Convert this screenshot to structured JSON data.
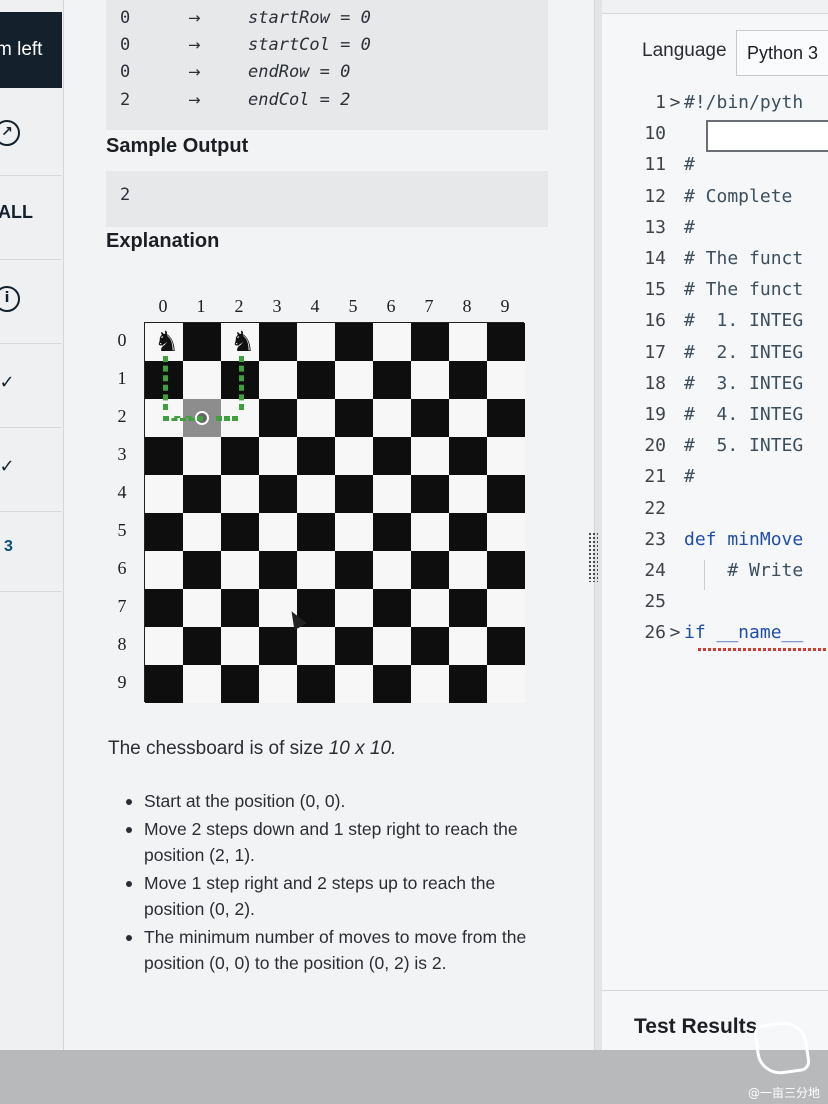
{
  "nav": {
    "timer_label": "m left",
    "all_label": "ALL",
    "question_number": "3",
    "icons": [
      "expand-icon",
      "info-icon",
      "check-icon",
      "check-icon"
    ]
  },
  "sample_input": {
    "rows": [
      {
        "value": "0",
        "arrow": "→",
        "desc": "startRow = 0"
      },
      {
        "value": "0",
        "arrow": "→",
        "desc": "startCol = 0"
      },
      {
        "value": "0",
        "arrow": "→",
        "desc": "endRow = 0"
      },
      {
        "value": "2",
        "arrow": "→",
        "desc": "endCol = 2"
      }
    ]
  },
  "sample_output": {
    "heading": "Sample Output",
    "value": "2"
  },
  "explanation": {
    "heading": "Explanation",
    "board": {
      "col_labels": [
        "0",
        "1",
        "2",
        "3",
        "4",
        "5",
        "6",
        "7",
        "8",
        "9"
      ],
      "row_labels": [
        "0",
        "1",
        "2",
        "3",
        "4",
        "5",
        "6",
        "7",
        "8",
        "9"
      ],
      "knight_positions": [
        [
          0,
          0
        ],
        [
          0,
          2
        ]
      ],
      "highlight_square": [
        2,
        1
      ]
    },
    "description_prefix": "The chessboard is of size ",
    "description_size": "10 x 10.",
    "bullets": [
      "Start at the position (0, 0).",
      "Move 2 steps down and 1 step right to reach the position (2, 1).",
      "Move 1 step right and 2 steps up to reach the position (0, 2).",
      "The minimum number of moves to move from the position (0, 0) to the position (0, 2) is 2."
    ]
  },
  "editor": {
    "language_label": "Language",
    "language_value": "Python 3",
    "lines": [
      {
        "num": "1",
        "fold": ">",
        "text": "#!/bin/pyth",
        "kind": "cmt"
      },
      {
        "num": "10",
        "fold": "",
        "text": "",
        "kind": "plain"
      },
      {
        "num": "11",
        "fold": "",
        "text": "#",
        "kind": "cmt"
      },
      {
        "num": "12",
        "fold": "",
        "text": "# Complete",
        "kind": "cmt"
      },
      {
        "num": "13",
        "fold": "",
        "text": "#",
        "kind": "cmt"
      },
      {
        "num": "14",
        "fold": "",
        "text": "# The funct",
        "kind": "cmt"
      },
      {
        "num": "15",
        "fold": "",
        "text": "# The funct",
        "kind": "cmt"
      },
      {
        "num": "16",
        "fold": "",
        "text": "#  1. INTEG",
        "kind": "cmt"
      },
      {
        "num": "17",
        "fold": "",
        "text": "#  2. INTEG",
        "kind": "cmt"
      },
      {
        "num": "18",
        "fold": "",
        "text": "#  3. INTEG",
        "kind": "cmt"
      },
      {
        "num": "19",
        "fold": "",
        "text": "#  4. INTEG",
        "kind": "cmt"
      },
      {
        "num": "20",
        "fold": "",
        "text": "#  5. INTEG",
        "kind": "cmt"
      },
      {
        "num": "21",
        "fold": "",
        "text": "#",
        "kind": "cmt"
      },
      {
        "num": "22",
        "fold": "",
        "text": "",
        "kind": "plain"
      },
      {
        "num": "23",
        "fold": "",
        "text": "def minMove",
        "kind": "kw"
      },
      {
        "num": "24",
        "fold": "",
        "text": "    # Write",
        "kind": "cmt"
      },
      {
        "num": "25",
        "fold": "",
        "text": "",
        "kind": "plain"
      },
      {
        "num": "26",
        "fold": ">",
        "text": "if __name__",
        "kind": "kw"
      }
    ],
    "results_title": "Test Results"
  },
  "watermark": {
    "text": "@一亩三分地"
  }
}
